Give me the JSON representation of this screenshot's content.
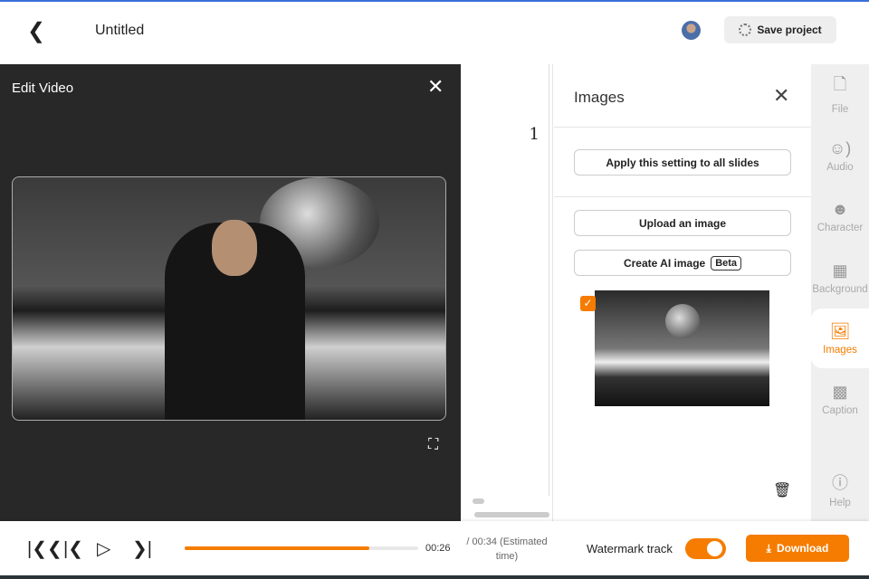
{
  "header": {
    "title": "Untitled",
    "save_label": "Save project"
  },
  "editor": {
    "title": "Edit Video"
  },
  "script": {
    "slide_number": "1"
  },
  "panel": {
    "title": "Images",
    "apply_all": "Apply this setting to all slides",
    "upload": "Upload an image",
    "create_ai": "Create AI image",
    "beta": "Beta"
  },
  "sidebar": {
    "items": [
      {
        "label": "File",
        "icon": "file-icon"
      },
      {
        "label": "Audio",
        "icon": "audio-icon"
      },
      {
        "label": "Character",
        "icon": "character-icon"
      },
      {
        "label": "Background",
        "icon": "background-icon"
      },
      {
        "label": "Images",
        "icon": "images-icon"
      },
      {
        "label": "Caption",
        "icon": "caption-icon"
      },
      {
        "label": "Help",
        "icon": "help-icon"
      }
    ]
  },
  "player": {
    "current_time": "00:26",
    "total_time": "/ 00:34 (Estimated time)",
    "progress_percent": 79,
    "watermark_label": "Watermark track",
    "watermark_on": true,
    "download_label": "Download"
  },
  "colors": {
    "accent": "#f57c00"
  }
}
